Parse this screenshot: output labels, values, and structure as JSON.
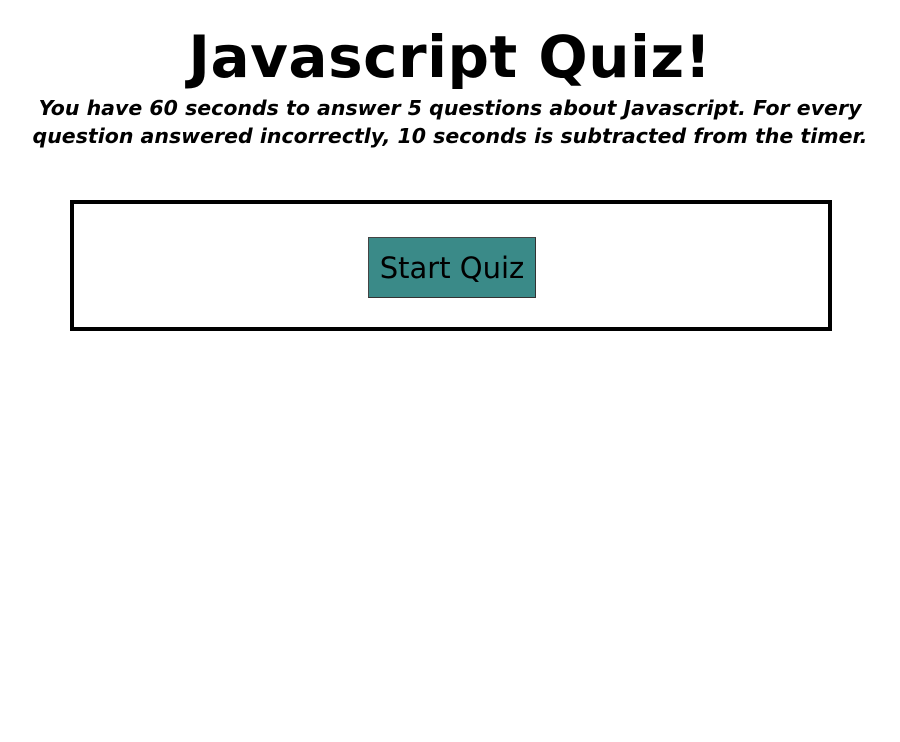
{
  "header": {
    "title": "Javascript Quiz!",
    "instructions": "You have 60 seconds to answer 5 questions about Javascript. For every question answered incorrectly, 10 seconds is subtracted from the timer."
  },
  "quiz": {
    "start_button_label": "Start Quiz"
  },
  "colors": {
    "button_background": "#3a8a88",
    "box_border": "#000000",
    "page_background": "#ffffff"
  }
}
